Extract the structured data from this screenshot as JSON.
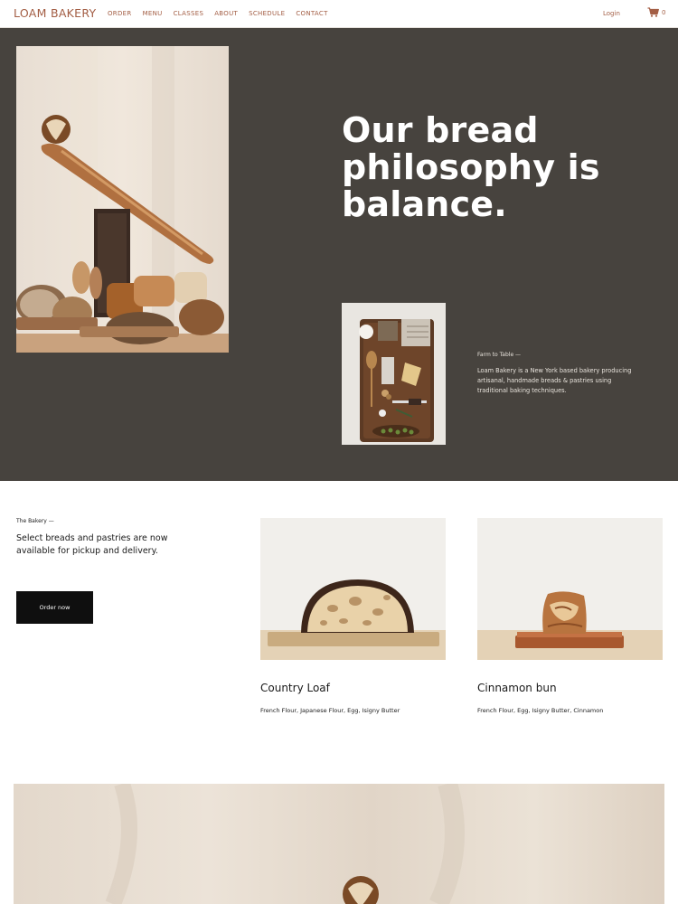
{
  "header": {
    "logo": "LOAM BAKERY",
    "nav": [
      "ORDER",
      "MENU",
      "CLASSES",
      "ABOUT",
      "SCHEDULE",
      "CONTACT"
    ],
    "login": "Login",
    "cart_count": "0"
  },
  "hero": {
    "title": "Our bread philosophy is balance.",
    "farm_label": "Farm to Table —",
    "farm_text": "Loam Bakery is a New York based bakery producing artisanal, handmade breads & pastries using traditional baking techniques."
  },
  "bakery": {
    "label": "The Bakery —",
    "text": "Select breads and pastries are now available for pickup and delivery.",
    "button": "Order now"
  },
  "products": [
    {
      "name": "Country Loaf",
      "ingredients": "French Flour, Japanese Flour, Egg, Isigny Butter"
    },
    {
      "name": "Cinnamon bun",
      "ingredients": "French Flour, Egg, Isigny Butter, Cinnamon"
    }
  ],
  "colors": {
    "accent": "#a35e45",
    "hero_bg": "#47433e",
    "button_bg": "#0f0f0f"
  },
  "icons": [
    "cart-icon"
  ]
}
